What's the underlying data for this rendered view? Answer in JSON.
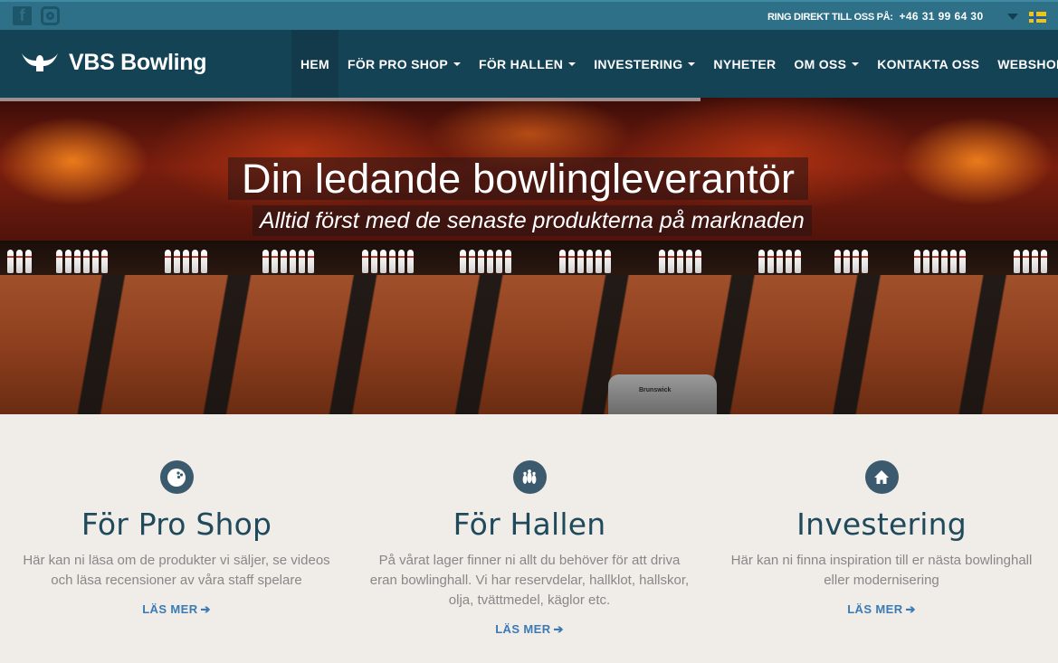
{
  "topbar": {
    "social": [
      "facebook-icon",
      "instagram-icon"
    ],
    "phone_label": "RING DIREKT TILL OSS PÅ:",
    "phone_number": "+46 31 99 64 30",
    "language": "swedish-flag-icon"
  },
  "nav": {
    "brand": "VBS Bowling",
    "items": [
      {
        "label": "HEM",
        "active": true,
        "dropdown": false
      },
      {
        "label": "FÖR PRO SHOP",
        "active": false,
        "dropdown": true
      },
      {
        "label": "FÖR HALLEN",
        "active": false,
        "dropdown": true
      },
      {
        "label": "INVESTERING",
        "active": false,
        "dropdown": true
      },
      {
        "label": "NYHETER",
        "active": false,
        "dropdown": false
      },
      {
        "label": "OM OSS",
        "active": false,
        "dropdown": true
      },
      {
        "label": "KONTAKTA OSS",
        "active": false,
        "dropdown": false
      },
      {
        "label": "WEBSHOP",
        "active": false,
        "dropdown": false
      }
    ]
  },
  "hero": {
    "title": "Din ledande bowlingleverantör",
    "subtitle": "Alltid först med de senaste produkterna på marknaden",
    "ball_return_label": "Brunswick"
  },
  "features": [
    {
      "icon": "bowling-ball-icon",
      "title": "För Pro Shop",
      "text": "Här kan ni läsa om de produkter vi säljer, se videos och läsa recensioner av våra staff spelare",
      "link": "LÄS MER"
    },
    {
      "icon": "bowling-pins-icon",
      "title": "För Hallen",
      "text": "På vårat lager finner ni allt du behöver för att driva eran bowlinghall. Vi har reservdelar, hallklot, hallskor, olja, tvättmedel, käglor etc.",
      "link": "LÄS MER"
    },
    {
      "icon": "home-icon",
      "title": "Investering",
      "text": "Här kan ni finna inspiration till er nästa bowlinghall eller modernisering",
      "link": "LÄS MER"
    }
  ],
  "colors": {
    "topbar": "#2d7088",
    "nav": "#144356",
    "feature_title": "#1f4a5c",
    "link": "#3a7ab5",
    "background": "#f0ece8"
  }
}
